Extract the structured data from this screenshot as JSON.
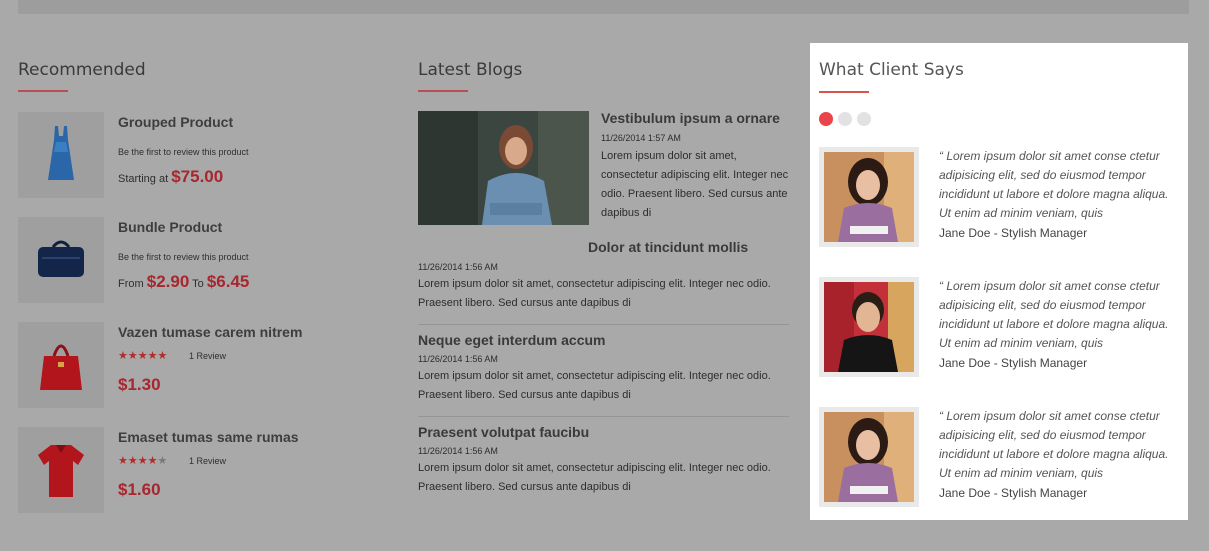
{
  "recommended": {
    "title": "Recommended",
    "items": [
      {
        "name": "Grouped Product",
        "review_text": "Be the first to review this product",
        "price_prefix": "Starting at",
        "price": "$75.00",
        "image": "blue-dress"
      },
      {
        "name": "Bundle Product",
        "review_text": "Be the first to review this product",
        "price_from_label": "From",
        "price_from": "$2.90",
        "price_to_label": "To",
        "price_to": "$6.45",
        "image": "navy-bag"
      },
      {
        "name": "Vazen tumase carem nitrem",
        "rating": 5,
        "rating_text": "1 Review",
        "price": "$1.30",
        "image": "red-handbag"
      },
      {
        "name": "Emaset tumas same rumas",
        "rating": 4,
        "rating_text": "1 Review",
        "price": "$1.60",
        "image": "red-shirt"
      }
    ]
  },
  "blogs": {
    "title": "Latest Blogs",
    "posts": [
      {
        "title": "Vestibulum ipsum a ornare",
        "date": "11/26/2014 1:57 AM",
        "text": "Lorem ipsum dolor sit amet, consectetur adipiscing elit. Integer nec odio. Praesent libero. Sed cursus ante dapibus di"
      },
      {
        "title": "Dolor at tincidunt mollis",
        "date": "11/26/2014 1:56 AM",
        "text": "Lorem ipsum dolor sit amet, consectetur adipiscing elit. Integer nec odio. Praesent libero. Sed cursus ante dapibus di"
      },
      {
        "title": "Neque eget interdum accum",
        "date": "11/26/2014 1:56 AM",
        "text": "Lorem ipsum dolor sit amet, consectetur adipiscing elit. Integer nec odio. Praesent libero. Sed cursus ante dapibus di"
      },
      {
        "title": "Praesent volutpat faucibu",
        "date": "11/26/2014 1:56 AM",
        "text": "Lorem ipsum dolor sit amet, consectetur adipiscing elit. Integer nec odio. Praesent libero. Sed cursus ante dapibus di"
      }
    ]
  },
  "testimonials": {
    "title": "What Client Says",
    "slide_count": 3,
    "active_slide": 1,
    "items": [
      {
        "quote": "“ Lorem ipsum dolor sit amet conse ctetur adipisicing elit, sed do eiusmod tempor incididunt ut labore et dolore magna aliqua. Ut enim ad minim veniam, quis",
        "author": "Jane Doe - Stylish Manager"
      },
      {
        "quote": "“ Lorem ipsum dolor sit amet conse ctetur adipisicing elit, sed do eiusmod tempor incididunt ut labore et dolore magna aliqua. Ut enim ad minim veniam, quis",
        "author": "Jane Doe - Stylish Manager"
      },
      {
        "quote": "“ Lorem ipsum dolor sit amet conse ctetur adipisicing elit, sed do eiusmod tempor incididunt ut labore et dolore magna aliqua. Ut enim ad minim veniam, quis",
        "author": "Jane Doe - Stylish Manager"
      }
    ]
  },
  "colors": {
    "overlay_bg": "#a9a9a9",
    "price": "#a8262e",
    "accent": "#e8444a",
    "panel_bg": "#ffffff"
  }
}
